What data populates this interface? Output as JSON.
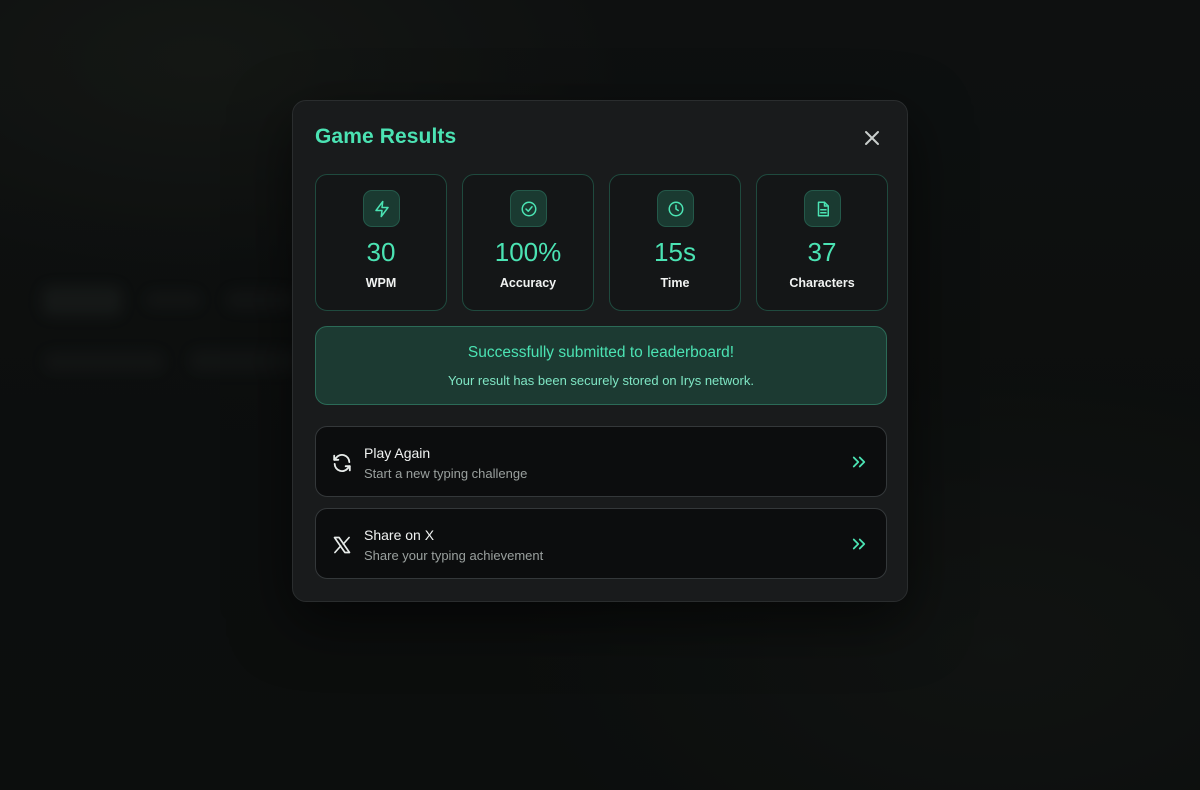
{
  "modal": {
    "title": "Game Results"
  },
  "stats": [
    {
      "icon": "lightning-icon",
      "value": "30",
      "label": "WPM"
    },
    {
      "icon": "check-circle-icon",
      "value": "100%",
      "label": "Accuracy"
    },
    {
      "icon": "clock-icon",
      "value": "15s",
      "label": "Time"
    },
    {
      "icon": "document-icon",
      "value": "37",
      "label": "Characters"
    }
  ],
  "success": {
    "title": "Successfully submitted to leaderboard!",
    "subtitle": "Your result has been securely stored on Irys network."
  },
  "actions": [
    {
      "icon": "refresh-icon",
      "title": "Play Again",
      "subtitle": "Start a new typing challenge"
    },
    {
      "icon": "x-logo-icon",
      "title": "Share on X",
      "subtitle": "Share your typing achievement"
    }
  ],
  "colors": {
    "accent": "#4be3b3",
    "modal_bg": "#191b1c",
    "success_bg": "#1c3a32"
  }
}
